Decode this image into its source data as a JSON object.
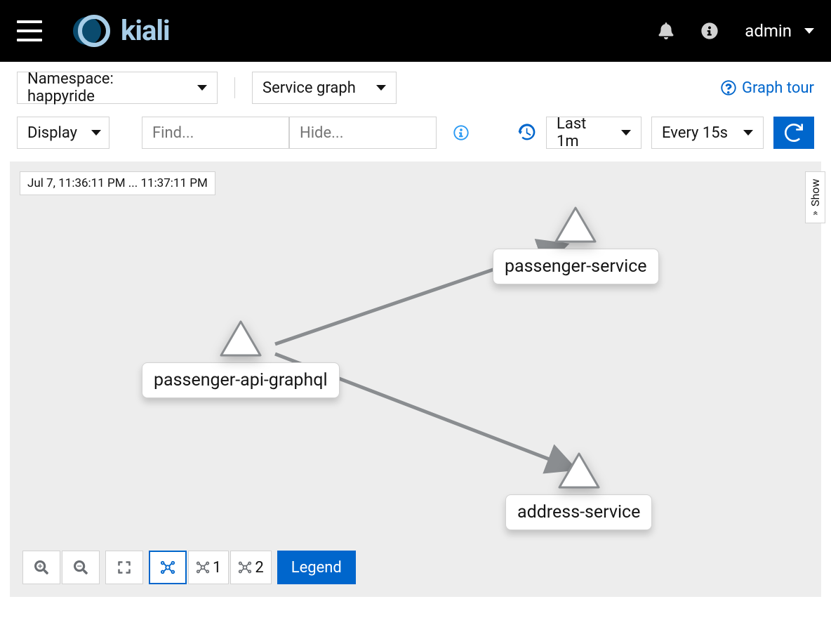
{
  "header": {
    "brand": "kiali",
    "user": "admin"
  },
  "toolbar": {
    "namespace_label": "Namespace: happyride",
    "graph_type_label": "Service graph",
    "graph_tour": "Graph tour",
    "display_label": "Display",
    "find_placeholder": "Find...",
    "hide_placeholder": "Hide...",
    "time_range_label": "Last 1m",
    "refresh_interval_label": "Every 15s"
  },
  "graph": {
    "time_text": "Jul 7, 11:36:11 PM ... 11:37:11 PM",
    "show_label": "Show",
    "nodes": {
      "source": "passenger-api-graphql",
      "target_top": "passenger-service",
      "target_bottom": "address-service"
    },
    "controls": {
      "layout_labels": [
        "1",
        "2"
      ],
      "legend": "Legend"
    }
  }
}
